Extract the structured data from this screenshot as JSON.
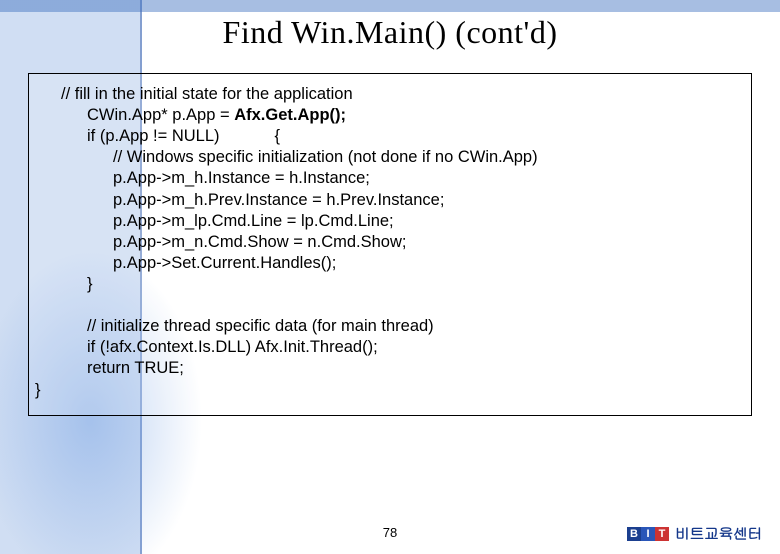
{
  "title": "Find Win.Main() (cont'd)",
  "code": {
    "c1": "// fill in the initial state for the application",
    "c2": "CWin.App* p.App = ",
    "c2b": "Afx.Get.App();",
    "c3a": "if (p.App != NULL)",
    "c3b": "{",
    "c4": "// Windows specific initialization (not done if no CWin.App)",
    "c5": "p.App->m_h.Instance = h.Instance;",
    "c6": "p.App->m_h.Prev.Instance = h.Prev.Instance;",
    "c7": "p.App->m_lp.Cmd.Line = lp.Cmd.Line;",
    "c8": "p.App->m_n.Cmd.Show = n.Cmd.Show;",
    "c9": "p.App->Set.Current.Handles();",
    "c10": "}",
    "c11": "// initialize thread specific data (for main thread)",
    "c12": "if (!afx.Context.Is.DLL) Afx.Init.Thread();",
    "c13": "return TRUE;",
    "c14": "}"
  },
  "page_number": "78",
  "brand": {
    "logo_letters": [
      "B",
      "I",
      "T"
    ],
    "text": "비트교육센터"
  }
}
